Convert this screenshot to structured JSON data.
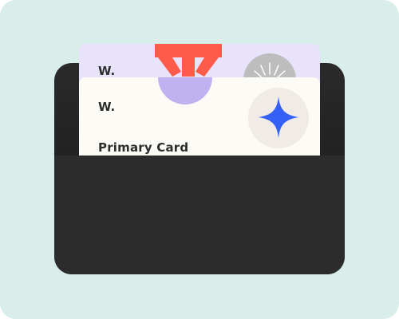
{
  "wallet": {
    "back_card": {
      "initial": "W.",
      "badge_icon": "sun-ray-icon"
    },
    "front_card": {
      "initial": "W.",
      "title": "Primary Card",
      "badge_icon": "four-point-star-icon"
    },
    "decoration_icon": "starburst-icon"
  },
  "colors": {
    "background": "#d9eeeb",
    "wallet": "#2c2c2c",
    "back_card": "#e8e2fa",
    "front_card": "#fcfbf6",
    "star": "#3560f5",
    "starburst": "#ff5a4a",
    "circle": "#c0b1f0",
    "sun_badge": "#bdbdbd"
  }
}
